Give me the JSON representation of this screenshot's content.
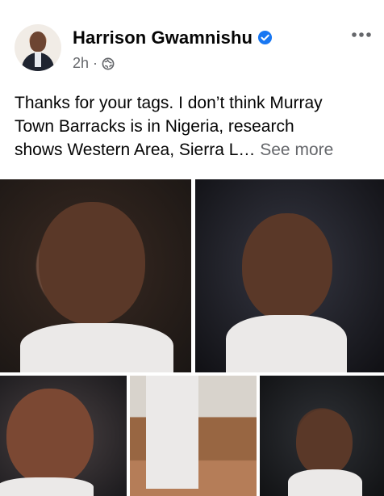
{
  "post": {
    "author": "Harrison Gwamnishu",
    "time": "2h",
    "separator": "·",
    "text_lines": [
      "Thanks for your tags. I don’t think Murray",
      "Town Barracks is in Nigeria, research",
      "shows Western Area, Sierra L…"
    ],
    "see_more": "See more"
  },
  "icons": {
    "verified": "verified-badge-icon",
    "privacy": "globe-icon",
    "more": "more-options-icon"
  },
  "colors": {
    "verified_blue": "#1877f2",
    "secondary_text": "#65676b",
    "primary_text": "#050505"
  },
  "photos": {
    "count": 5
  }
}
